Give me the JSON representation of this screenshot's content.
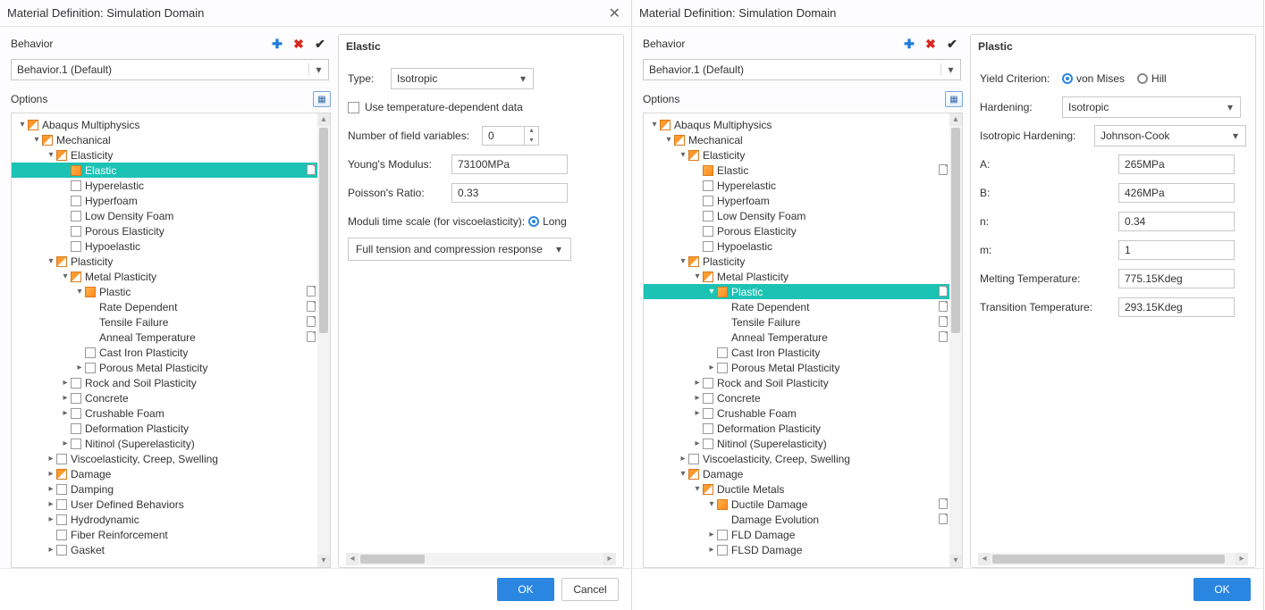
{
  "title": "Material Definition: Simulation Domain",
  "behavior_label": "Behavior",
  "behavior_value": "Behavior.1 (Default)",
  "options_label": "Options",
  "tree_common": {
    "root": "Abaqus Multiphysics",
    "mech": "Mechanical",
    "elasticity": "Elasticity",
    "elastic": "Elastic",
    "hyperelastic": "Hyperelastic",
    "hyperfoam": "Hyperfoam",
    "lowdensity": "Low Density Foam",
    "porouselast": "Porous Elasticity",
    "hypoelastic": "Hypoelastic",
    "plasticity": "Plasticity",
    "metalplast": "Metal Plasticity",
    "plastic": "Plastic",
    "ratedep": "Rate Dependent",
    "tensfail": "Tensile Failure",
    "annealtemp": "Anneal Temperature",
    "castiron": "Cast Iron Plasticity",
    "porousmetal": "Porous Metal Plasticity",
    "rocksoil": "Rock and Soil Plasticity",
    "concrete": "Concrete",
    "crushfoam": "Crushable Foam",
    "defplast": "Deformation Plasticity",
    "nitinol": "Nitinol (Superelasticity)",
    "visco": "Viscoelasticity, Creep, Swelling",
    "damage": "Damage",
    "damping": "Damping",
    "userdef": "User Defined Behaviors",
    "hydro": "Hydrodynamic",
    "fiber": "Fiber Reinforcement",
    "gasket": "Gasket",
    "ductmet": "Ductile Metals",
    "ductdmg": "Ductile Damage",
    "dmgevo": "Damage Evolution",
    "flddmg": "FLD Damage",
    "flsddmg": "FLSD Damage"
  },
  "elastic_panel": {
    "title": "Elastic",
    "type_label": "Type:",
    "type_value": "Isotropic",
    "temp_dep": "Use temperature-dependent data",
    "nfield_label": "Number of field variables:",
    "nfield_value": "0",
    "young_label": "Young's Modulus:",
    "young_value": "73100MPa",
    "poisson_label": "Poisson's Ratio:",
    "poisson_value": "0.33",
    "moduli_label": "Moduli time scale (for viscoelasticity):",
    "moduli_value": "Long",
    "fulltension": "Full tension and compression response "
  },
  "plastic_panel": {
    "title": "Plastic",
    "yield_label": "Yield Criterion:",
    "yield_von": "von Mises",
    "yield_hill": "Hill",
    "hardening_label": "Hardening:",
    "hardening_value": "Isotropic",
    "iso_hard_label": "Isotropic Hardening:",
    "iso_hard_value": "Johnson-Cook",
    "A_label": "A:",
    "A_value": "265MPa",
    "B_label": "B:",
    "B_value": "426MPa",
    "n_label": "n:",
    "n_value": "0.34",
    "m_label": "m:",
    "m_value": "1",
    "melt_label": "Melting Temperature:",
    "melt_value": "775.15Kdeg",
    "trans_label": "Transition Temperature:",
    "trans_value": "293.15Kdeg"
  },
  "buttons": {
    "ok": "OK",
    "cancel": "Cancel"
  }
}
